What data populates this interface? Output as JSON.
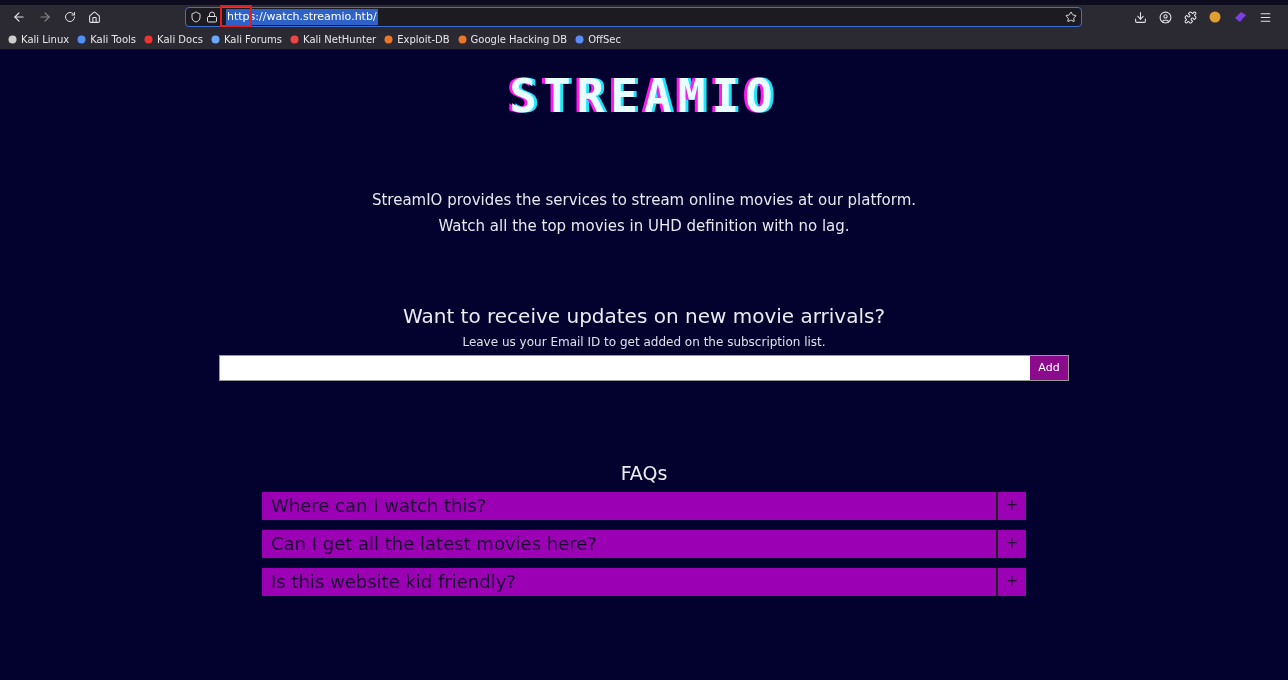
{
  "browser": {
    "url": "https://watch.streamio.htb/",
    "bookmarks": [
      "Kali Linux",
      "Kali Tools",
      "Kali Docs",
      "Kali Forums",
      "Kali NetHunter",
      "Exploit-DB",
      "Google Hacking DB",
      "OffSec"
    ]
  },
  "page": {
    "logo": "STREAMIO",
    "intro": [
      "StreamIO provides the services to stream online movies at our platform.",
      "Watch all the top movies in UHD definition with no lag."
    ],
    "subscribe": {
      "heading": "Want to receive updates on new movie arrivals?",
      "subtext": "Leave us your Email ID to get added on the subscription list.",
      "button": "Add"
    },
    "faq": {
      "title": "FAQs",
      "items": [
        {
          "question": "Where can I watch this?",
          "toggle": "+",
          "expanded": false
        },
        {
          "question": "Can I get all the latest movies here?",
          "toggle": "+",
          "expanded": false
        },
        {
          "question": "Is this website kid friendly?",
          "toggle": "+",
          "expanded": false
        }
      ]
    }
  }
}
